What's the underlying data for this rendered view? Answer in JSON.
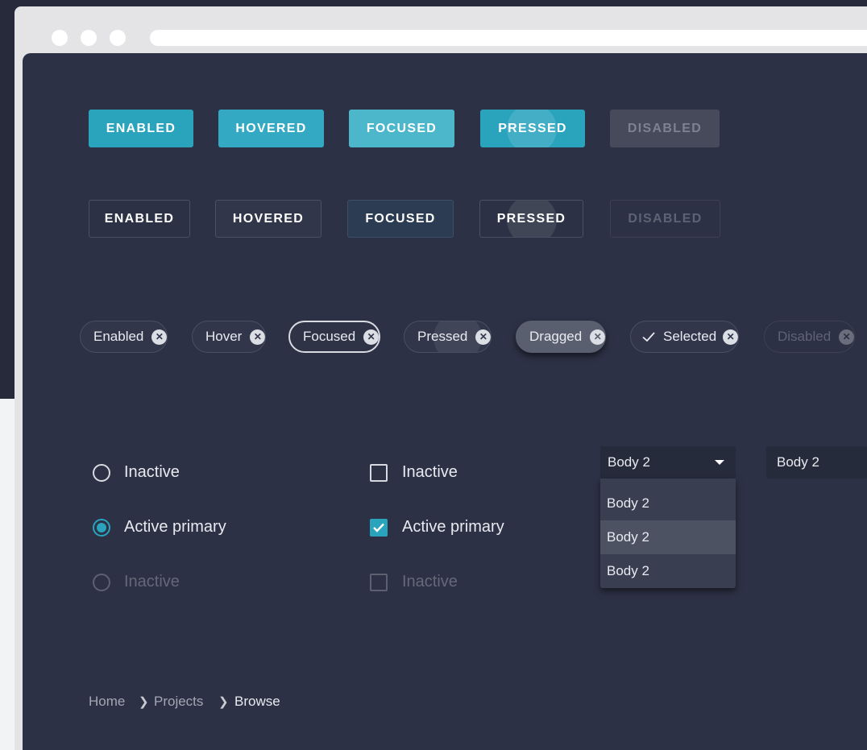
{
  "contained_buttons": [
    "ENABLED",
    "HOVERED",
    "FOCUSED",
    "PRESSED",
    "DISABLED"
  ],
  "outlined_buttons": [
    "ENABLED",
    "HOVERED",
    "FOCUSED",
    "PRESSED",
    "DISABLED"
  ],
  "chips": [
    "Enabled",
    "Hover",
    "Focused",
    "Pressed",
    "Dragged",
    "Selected",
    "Disabled"
  ],
  "radios": [
    "Inactive",
    "Active primary",
    "Inactive"
  ],
  "checkboxes": [
    "Inactive",
    "Active primary",
    "Inactive"
  ],
  "select": {
    "value": "Body 2",
    "options": [
      "Body 2",
      "Body 2",
      "Body 2"
    ]
  },
  "select_closed": {
    "value": "Body 2"
  },
  "breadcrumb": [
    "Home",
    "Projects",
    "Browse"
  ],
  "colors": {
    "accent": "#2aa3bd",
    "panel": "#2c3145",
    "background": "#262a3a"
  }
}
